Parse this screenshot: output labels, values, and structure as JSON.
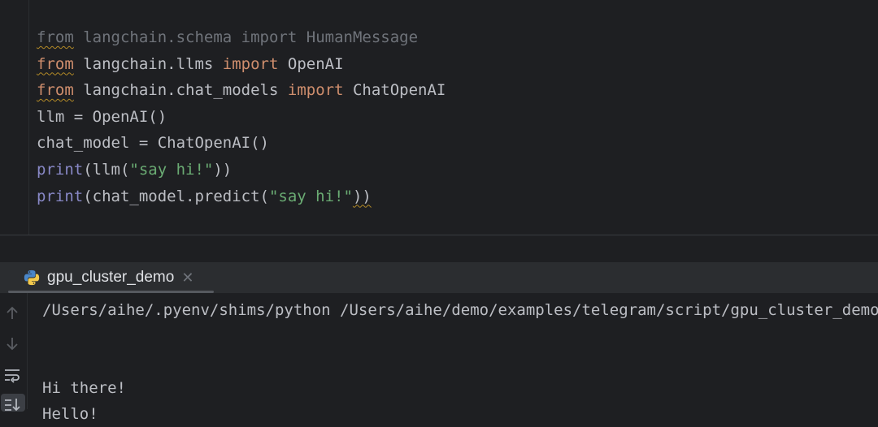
{
  "editor": {
    "lines": [
      {
        "dim": true,
        "parts": [
          [
            "kw",
            "from"
          ],
          [
            "txt",
            " langchain.schema "
          ],
          [
            "kw",
            "import"
          ],
          [
            "txt",
            " HumanMessage"
          ]
        ]
      },
      {
        "dim": false,
        "parts": [
          [
            "kw",
            "from"
          ],
          [
            "txt",
            " langchain.llms "
          ],
          [
            "kw",
            "import"
          ],
          [
            "txt",
            " OpenAI"
          ]
        ]
      },
      {
        "dim": false,
        "parts": [
          [
            "kw",
            "from"
          ],
          [
            "txt",
            " langchain.chat_models "
          ],
          [
            "kw",
            "import"
          ],
          [
            "txt",
            " ChatOpenAI"
          ]
        ]
      },
      {
        "dim": false,
        "parts": [
          [
            "txt",
            "llm = OpenAI()"
          ]
        ]
      },
      {
        "dim": false,
        "parts": [
          [
            "txt",
            "chat_model = ChatOpenAI()"
          ]
        ]
      },
      {
        "dim": false,
        "parts": [
          [
            "fn",
            "print"
          ],
          [
            "txt",
            "(llm("
          ],
          [
            "str",
            "\"say hi!\""
          ],
          [
            "txt",
            "))"
          ]
        ]
      },
      {
        "dim": false,
        "parts": [
          [
            "fn",
            "print"
          ],
          [
            "txt",
            "(chat_model.predict("
          ],
          [
            "str",
            "\"say hi!\""
          ],
          [
            "txt",
            "))"
          ]
        ]
      }
    ]
  },
  "run_panel": {
    "tab_label": "gpu_cluster_demo",
    "tab_close": "✕",
    "output": [
      "/Users/aihe/.pyenv/shims/python /Users/aihe/demo/examples/telegram/script/gpu_cluster_demo.py",
      "",
      "",
      "Hi there!",
      "Hello!"
    ],
    "icons": [
      "arrow-up-icon",
      "arrow-down-icon",
      "soft-wrap-icon",
      "scroll-to-end-icon"
    ]
  },
  "colors": {
    "keyword": "#cf8e6d",
    "builtin": "#8888c6",
    "string": "#6aab73",
    "text": "#bcbec4",
    "background": "#1e1f22"
  }
}
